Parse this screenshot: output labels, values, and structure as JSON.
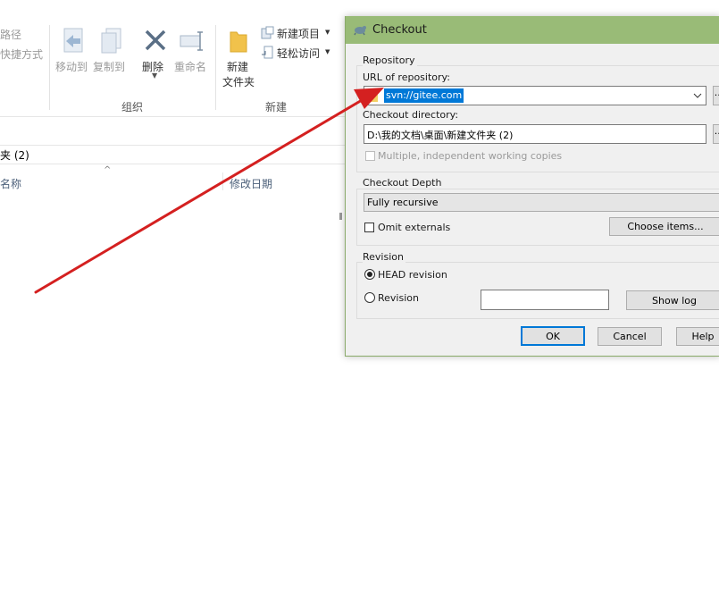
{
  "explorer": {
    "ribbon": {
      "top_left_1": "路径",
      "top_left_2": "快捷方式",
      "move_to": "移动到",
      "copy_to": "复制到",
      "delete": "删除",
      "rename": "重命名",
      "organize_group": "组织",
      "new_folder_line1": "新建",
      "new_folder_line2": "文件夹",
      "new_item": "新建项目",
      "easy_access": "轻松访问",
      "new_group": "新建"
    },
    "address": "夹 (2)",
    "columns": {
      "name": "名称",
      "date_modified": "修改日期"
    }
  },
  "dialog": {
    "title": "Checkout",
    "repository_group": "Repository",
    "url_label": "URL of repository:",
    "url_value": "svn://gitee.com",
    "dir_label": "Checkout directory:",
    "dir_value": "D:\\我的文档\\桌面\\新建文件夹 (2)",
    "browse_label": "...",
    "multiple_copies": "Multiple, independent working copies",
    "depth_group": "Checkout Depth",
    "depth_value": "Fully recursive",
    "omit_externals": "Omit externals",
    "choose_items": "Choose items...",
    "revision_group": "Revision",
    "head_revision": "HEAD revision",
    "revision": "Revision",
    "revision_value": "",
    "show_log": "Show log",
    "ok": "OK",
    "cancel": "Cancel",
    "help": "Help"
  },
  "colors": {
    "title_bar": "#99bb77",
    "annotation_arrow": "#d42020",
    "selection": "#0078d7"
  }
}
